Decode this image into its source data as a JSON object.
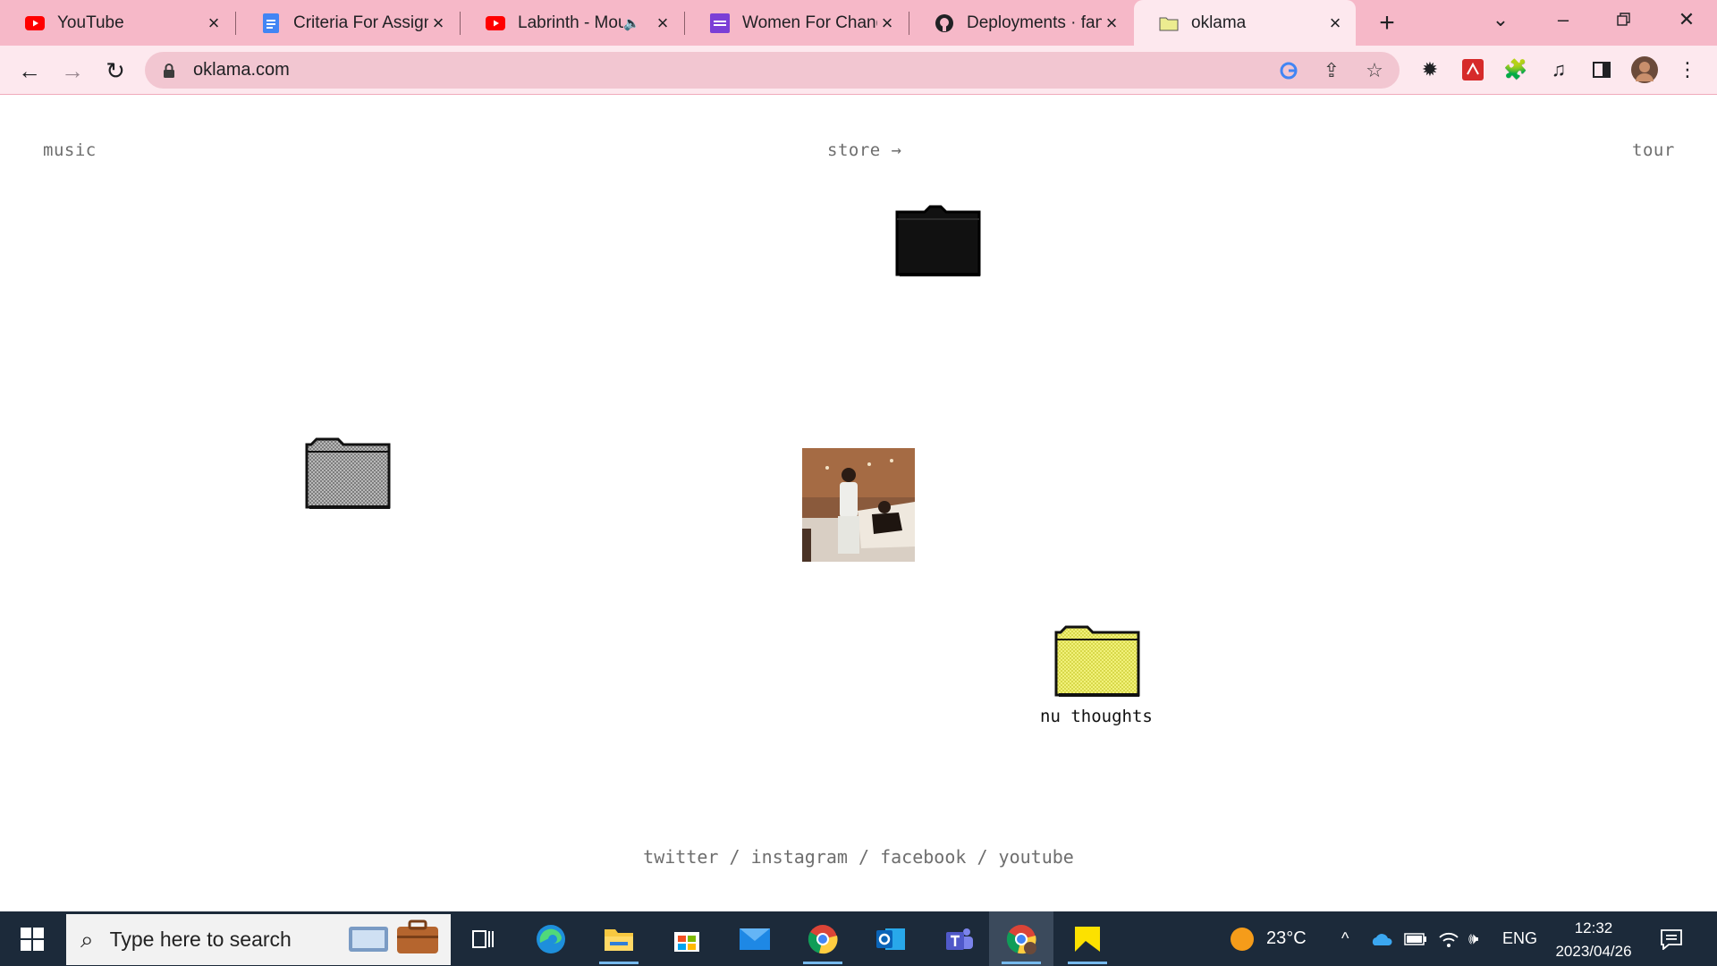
{
  "browser": {
    "tabs": [
      {
        "title": "YouTube",
        "icon": "youtube-icon"
      },
      {
        "title": "Criteria For Assignm",
        "icon": "google-docs-icon"
      },
      {
        "title": "Labrinth - Mou",
        "icon": "youtube-icon",
        "audio": true
      },
      {
        "title": "Women For Change",
        "icon": "women-for-change-icon"
      },
      {
        "title": "Deployments · fane",
        "icon": "github-icon"
      },
      {
        "title": "oklama",
        "icon": "folder-icon",
        "active": true
      }
    ],
    "url": "oklama.com",
    "colors": {
      "tabstrip": "#f6b8c8",
      "toolbar": "#fde8ee",
      "omnibox": "#f2c6d1"
    }
  },
  "site": {
    "nav": {
      "music": "music",
      "store": "store →",
      "tour": "tour"
    },
    "folders": [
      {
        "name": "black-folder",
        "color": "#111111",
        "label": ""
      },
      {
        "name": "grey-folder",
        "color": "#9a9a9a",
        "label": ""
      },
      {
        "name": "yellow-folder",
        "color": "#e6e65a",
        "label": "nu thoughts"
      }
    ],
    "socials": {
      "twitter": "twitter",
      "instagram": "instagram",
      "facebook": "facebook",
      "youtube": "youtube",
      "separator": " / "
    }
  },
  "taskbar": {
    "search_placeholder": "Type here to search",
    "weather": "23°C",
    "language": "ENG",
    "time": "12:32",
    "date": "2023/04/26",
    "apps": [
      "task-view-icon",
      "edge-icon",
      "file-explorer-icon",
      "store-icon",
      "mail-icon",
      "chrome-icon",
      "outlook-icon",
      "teams-icon",
      "chrome-profile-icon",
      "sticky-notes-icon"
    ]
  }
}
